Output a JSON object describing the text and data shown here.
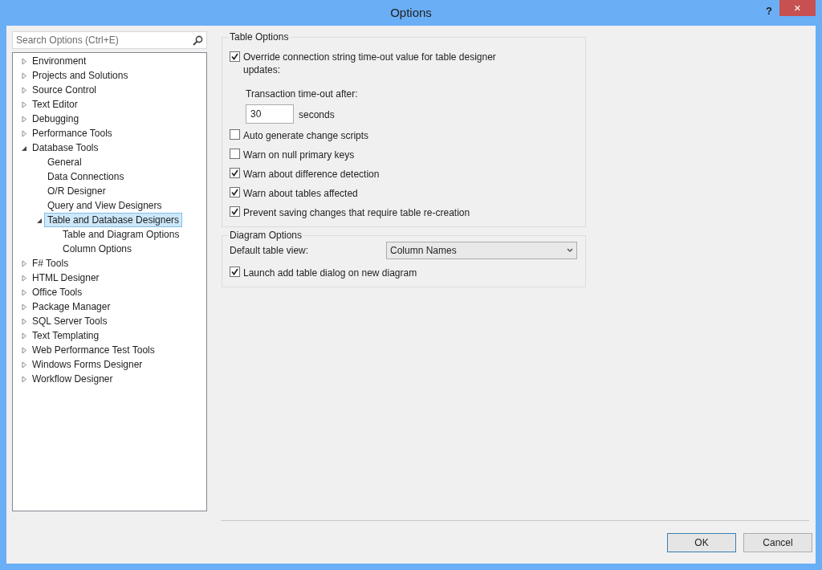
{
  "window": {
    "title": "Options",
    "help": "?",
    "close": "×"
  },
  "search": {
    "placeholder": "Search Options (Ctrl+E)"
  },
  "tree": [
    {
      "label": "Environment",
      "expanded": false,
      "selected": false
    },
    {
      "label": "Projects and Solutions",
      "expanded": false,
      "selected": false
    },
    {
      "label": "Source Control",
      "expanded": false,
      "selected": false
    },
    {
      "label": "Text Editor",
      "expanded": false,
      "selected": false
    },
    {
      "label": "Debugging",
      "expanded": false,
      "selected": false
    },
    {
      "label": "Performance Tools",
      "expanded": false,
      "selected": false
    },
    {
      "label": "Database Tools",
      "expanded": true,
      "selected": false,
      "children": [
        {
          "label": "General",
          "selected": false
        },
        {
          "label": "Data Connections",
          "selected": false
        },
        {
          "label": "O/R Designer",
          "selected": false
        },
        {
          "label": "Query and View Designers",
          "selected": false
        },
        {
          "label": "Table and Database Designers",
          "expanded": true,
          "selected": true,
          "children": [
            {
              "label": "Table and Diagram Options",
              "selected": false
            },
            {
              "label": "Column Options",
              "selected": false
            }
          ]
        }
      ]
    },
    {
      "label": "F# Tools",
      "expanded": false,
      "selected": false
    },
    {
      "label": "HTML Designer",
      "expanded": false,
      "selected": false
    },
    {
      "label": "Office Tools",
      "expanded": false,
      "selected": false
    },
    {
      "label": "Package Manager",
      "expanded": false,
      "selected": false
    },
    {
      "label": "SQL Server Tools",
      "expanded": false,
      "selected": false
    },
    {
      "label": "Text Templating",
      "expanded": false,
      "selected": false
    },
    {
      "label": "Web Performance Test Tools",
      "expanded": false,
      "selected": false
    },
    {
      "label": "Windows Forms Designer",
      "expanded": false,
      "selected": false
    },
    {
      "label": "Workflow Designer",
      "expanded": false,
      "selected": false
    }
  ],
  "table_options": {
    "title": "Table Options",
    "override": {
      "label": "Override connection string time-out value for table designer updates:",
      "checked": true
    },
    "timeout_label": "Transaction time-out after:",
    "timeout_value": "30",
    "timeout_unit": "seconds",
    "checkboxes": [
      {
        "label": "Auto generate change scripts",
        "checked": false
      },
      {
        "label": "Warn on null primary keys",
        "checked": false
      },
      {
        "label": "Warn about difference detection",
        "checked": true
      },
      {
        "label": "Warn about tables affected",
        "checked": true
      },
      {
        "label": "Prevent saving changes that require table re-creation",
        "checked": true
      }
    ]
  },
  "diagram_options": {
    "title": "Diagram Options",
    "view_label": "Default table view:",
    "view_value": "Column Names",
    "checkboxes": [
      {
        "label": "Launch add table dialog on new diagram",
        "checked": true
      }
    ]
  },
  "buttons": [
    "OK",
    "Cancel"
  ]
}
